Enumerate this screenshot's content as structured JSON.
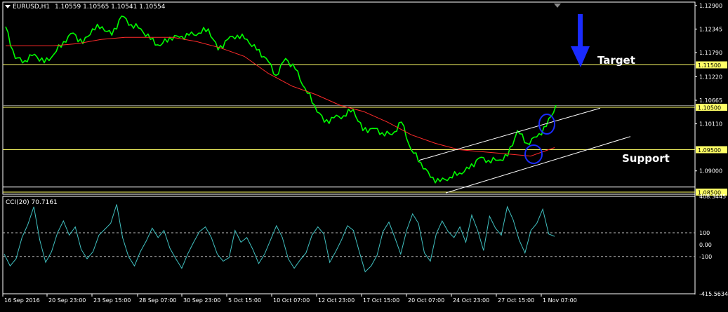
{
  "header": {
    "symbol": "EURUSD,H1",
    "ohlc": "1.10559 1.10565 1.10541 1.10554"
  },
  "indicator": {
    "label": "CCI(20) 70.7161",
    "axis_ticks": [
      "408.3445",
      "100",
      "0.00",
      "-100",
      "-415.5634"
    ]
  },
  "annotations": {
    "target": "Target",
    "support": "Support"
  },
  "price_axis": {
    "ticks": [
      "1.12900",
      "1.12345",
      "1.11790",
      "1.11220",
      "1.10665",
      "1.10110",
      "1.09000"
    ],
    "level_labels": [
      "1.11500",
      "1.10500",
      "1.09500",
      "1.08500"
    ]
  },
  "time_axis": {
    "labels": [
      "16 Sep 2016",
      "20 Sep 23:00",
      "23 Sep 15:00",
      "28 Sep 07:00",
      "30 Sep 23:00",
      "5 Oct 15:00",
      "10 Oct 07:00",
      "12 Oct 23:00",
      "17 Oct 15:00",
      "20 Oct 07:00",
      "24 Oct 23:00",
      "27 Oct 15:00",
      "1 Nov 07:00"
    ]
  },
  "colors": {
    "background": "#000000",
    "price_line": "#00ff00",
    "moving_average": "#ff2a2a",
    "level_line": "#ffff66",
    "channel_line": "#ffffff",
    "cci_line": "#40c0c0",
    "circle": "#1a2bff",
    "target_arrow": "#1a2bff"
  },
  "chart_data": [
    {
      "type": "line",
      "title": "EURUSD,H1",
      "x_labels": [
        "16 Sep 2016",
        "20 Sep 23:00",
        "23 Sep 15:00",
        "28 Sep 07:00",
        "30 Sep 23:00",
        "5 Oct 15:00",
        "10 Oct 07:00",
        "12 Oct 23:00",
        "17 Oct 15:00",
        "20 Oct 07:00",
        "24 Oct 23:00",
        "27 Oct 15:00",
        "1 Nov 07:00"
      ],
      "ylim": [
        1.0845,
        1.1298
      ],
      "grid": false,
      "series": [
        {
          "name": "price",
          "values": [
            1.124,
            1.1165,
            1.116,
            1.1175,
            1.1155,
            1.1175,
            1.1205,
            1.1225,
            1.12,
            1.1235,
            1.124,
            1.122,
            1.1265,
            1.1245,
            1.1235,
            1.121,
            1.1195,
            1.1215,
            1.1215,
            1.122,
            1.1225,
            1.1235,
            1.1185,
            1.121,
            1.122,
            1.121,
            1.1185,
            1.1165,
            1.1125,
            1.1165,
            1.114,
            1.1095,
            1.1055,
            1.1015,
            1.1025,
            1.103,
            1.1045,
            1.0995,
            1.1,
            1.099,
            1.0985,
            1.1015,
            1.095,
            1.092,
            1.0885,
            1.0875,
            1.0885,
            1.0895,
            1.0905,
            1.093,
            1.0925,
            1.0925,
            1.0935,
            1.0995,
            1.0965,
            1.098,
            1.1005,
            1.1055
          ]
        },
        {
          "name": "moving average",
          "values": [
            1.1195,
            1.1195,
            1.1195,
            1.12,
            1.121,
            1.1215,
            1.1215,
            1.1215,
            1.1205,
            1.119,
            1.117,
            1.113,
            1.11,
            1.108,
            1.1055,
            1.104,
            1.1015,
            1.0985,
            1.0965,
            1.095,
            1.0945,
            1.094,
            1.0935,
            1.0955
          ]
        }
      ],
      "horizontal_levels": [
        1.115,
        1.105,
        1.095,
        1.085
      ],
      "channel": {
        "upper": [
          [
            1.0925,
            1.1045
          ]
        ],
        "lower": [
          [
            1.0855,
            1.0985
          ]
        ]
      }
    },
    {
      "type": "line",
      "title": "CCI(20) 70.7161",
      "ylim": [
        -415.5634,
        408.3445
      ],
      "levels": [
        100,
        0,
        -100
      ],
      "series": [
        {
          "name": "CCI(20)",
          "values": [
            -80,
            -180,
            -120,
            60,
            170,
            320,
            40,
            -150,
            -60,
            100,
            200,
            80,
            150,
            -40,
            -120,
            -60,
            80,
            130,
            180,
            340,
            60,
            -100,
            -180,
            -60,
            30,
            140,
            60,
            120,
            -30,
            -120,
            -200,
            -80,
            20,
            110,
            150,
            60,
            -80,
            -140,
            -110,
            120,
            20,
            60,
            -40,
            -160,
            -80,
            40,
            160,
            60,
            -120,
            -200,
            -130,
            -70,
            80,
            150,
            90,
            -150,
            -60,
            40,
            160,
            120,
            -60,
            -230,
            -180,
            -90,
            110,
            190,
            60,
            -80,
            120,
            260,
            180,
            -70,
            -140,
            90,
            200,
            110,
            60,
            150,
            20,
            250,
            120,
            -50,
            240,
            140,
            80,
            320,
            210,
            40,
            -70,
            120,
            180,
            300,
            90,
            70
          ]
        }
      ]
    }
  ]
}
